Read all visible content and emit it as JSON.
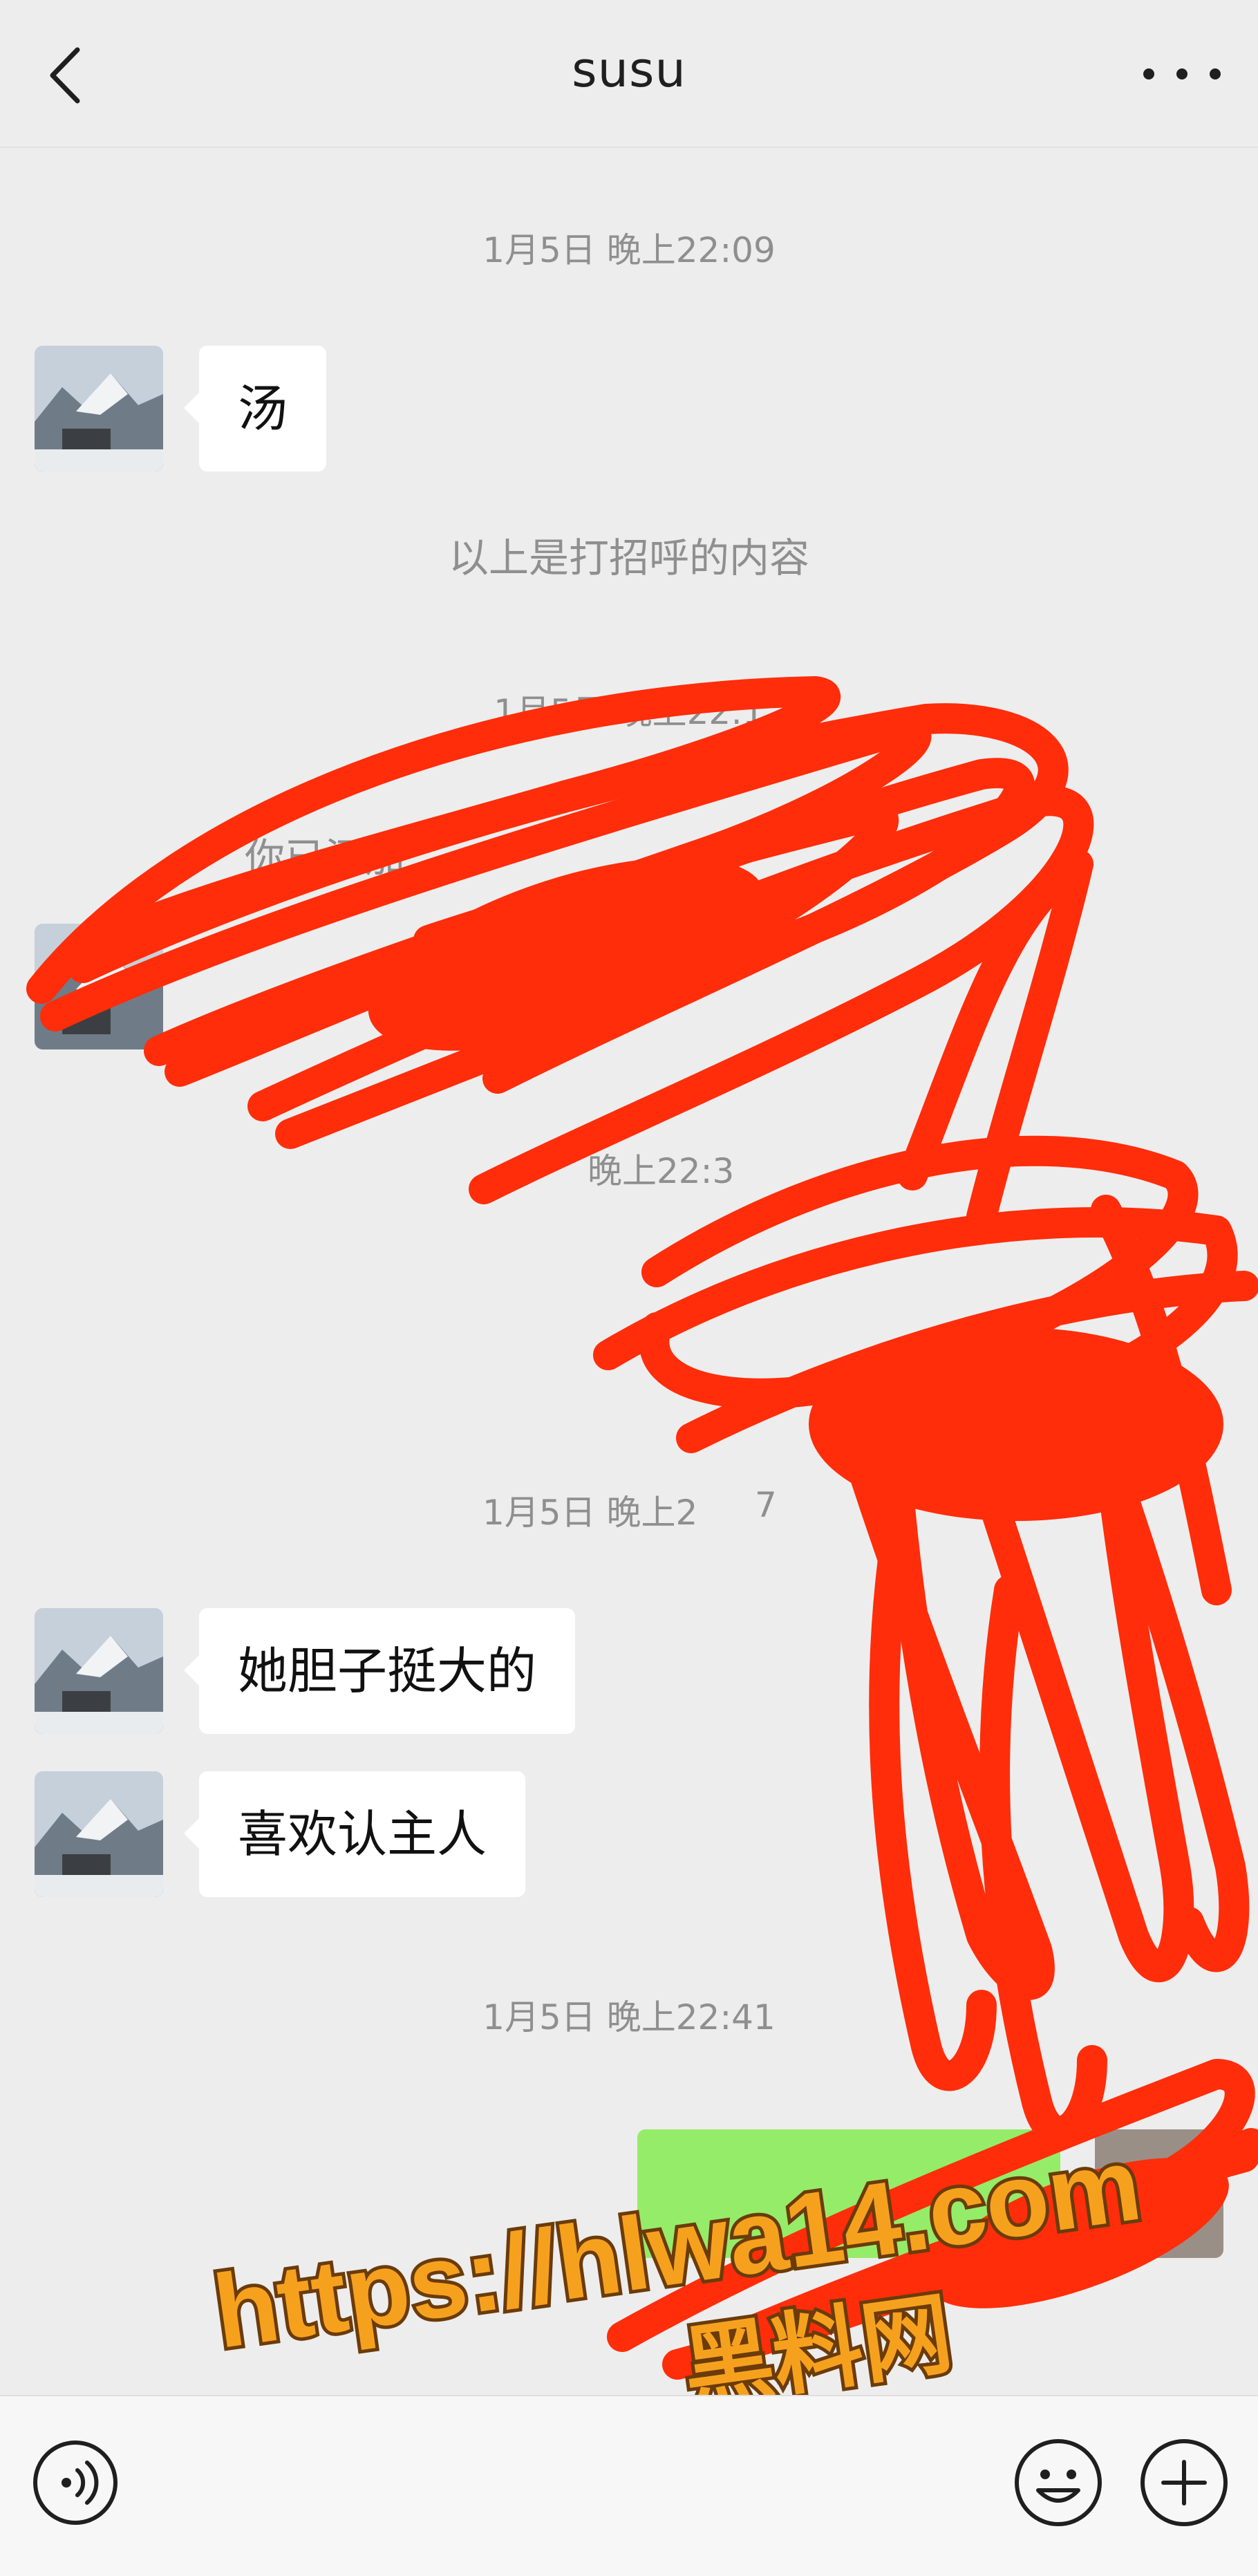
{
  "header": {
    "title": "susu",
    "back_icon": "chevron-left-icon",
    "more_icon": "more-horizontal-icon"
  },
  "chat": {
    "timestamps": [
      "1月5日 晚上22:09",
      "1月5日 晚上22:1",
      "晚上22:3",
      "1月5日 晚上2",
      "7",
      "1月5日 晚上22:41"
    ],
    "system_messages": [
      "以上是打招呼的内容",
      "你已添加"
    ],
    "messages": [
      {
        "sender": "susu",
        "text": "汤"
      },
      {
        "sender": "susu",
        "text": "她胆子挺大的"
      },
      {
        "sender": "susu",
        "text": "喜欢认主人"
      }
    ]
  },
  "watermark": {
    "url": "https://hlwa14.com",
    "name": "黑料网"
  },
  "input_bar": {
    "voice_icon": "voice-icon",
    "emoji_icon": "emoji-icon",
    "plus_icon": "plus-icon"
  },
  "colors": {
    "background": "#ededed",
    "bubble_in": "#ffffff",
    "bubble_out": "#95ec69",
    "scribble": "#ff2d0a",
    "watermark_fill": "#f6a11e"
  }
}
